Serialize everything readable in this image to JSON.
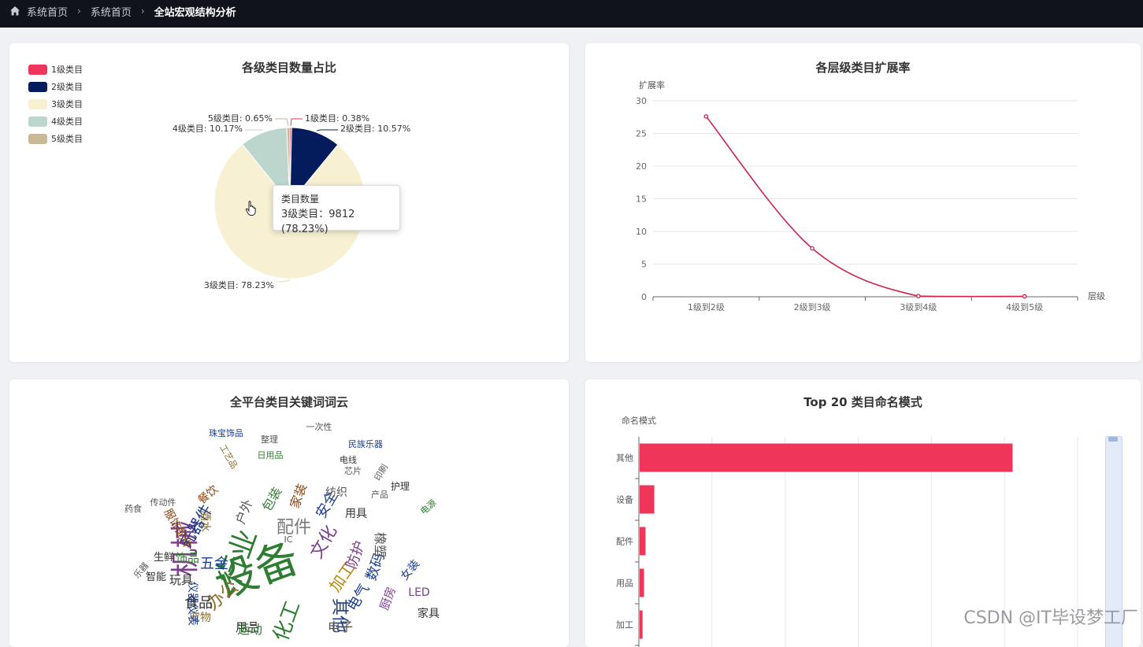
{
  "breadcrumb": {
    "items": [
      "系统首页",
      "系统首页",
      "全站宏观结构分析"
    ]
  },
  "pie_card": {
    "title": "各级类目数量占比",
    "legend": [
      {
        "label": "1级类目",
        "color": "#f0355a"
      },
      {
        "label": "2级类目",
        "color": "#051c5c"
      },
      {
        "label": "3级类目",
        "color": "#f8f0d2"
      },
      {
        "label": "4级类目",
        "color": "#bdd6cd"
      },
      {
        "label": "5级类目",
        "color": "#c8b895"
      }
    ],
    "slice_labels": [
      "1级类目: 0.38%",
      "2级类目: 10.57%",
      "3级类目: 78.23%",
      "4级类目: 10.17%",
      "5级类目: 0.65%"
    ],
    "tooltip": {
      "title": "类目数量",
      "text": "3级类目：9812 (78.23%)"
    }
  },
  "line_card": {
    "title": "各层级类目扩展率",
    "ylabel": "扩展率",
    "xlabel": "层级"
  },
  "cloud_card": {
    "title": "全平台类目关键词词云",
    "words": [
      {
        "t": "设备",
        "color": "#2e7d32"
      },
      {
        "t": "机械",
        "color": "#7b3f8c"
      },
      {
        "t": "行业",
        "color": "#2e7d32"
      },
      {
        "t": "配件",
        "color": "#7a7a7a"
      },
      {
        "t": "文化",
        "color": "#7b3f8c"
      },
      {
        "t": "加工",
        "color": "#b8860b"
      },
      {
        "t": "其他",
        "color": "#1a3c8c"
      },
      {
        "t": "化工",
        "color": "#2e7d32"
      },
      {
        "t": "办公",
        "color": "#8b6d2e"
      },
      {
        "t": "元器件",
        "color": "#1a3c8c"
      },
      {
        "t": "防护",
        "color": "#7b3f8c"
      },
      {
        "t": "安全",
        "color": "#1a3c8c"
      },
      {
        "t": "家装",
        "color": "#8b4513"
      },
      {
        "t": "户外",
        "color": "#555"
      },
      {
        "t": "包装",
        "color": "#2e7d32"
      },
      {
        "t": "食品",
        "color": "#333"
      },
      {
        "t": "五金",
        "color": "#1a3c8c"
      },
      {
        "t": "纺织",
        "color": "#555"
      },
      {
        "t": "用具",
        "color": "#333"
      },
      {
        "t": "数码",
        "color": "#1a3c8c"
      },
      {
        "t": "电气",
        "color": "#1a3c8c"
      },
      {
        "t": "厨房",
        "color": "#7b3f8c"
      },
      {
        "t": "饰品",
        "color": "#2e7d32"
      },
      {
        "t": "玩具",
        "color": "#333"
      },
      {
        "t": "服饰配件",
        "color": "#8b4513"
      },
      {
        "t": "用品",
        "color": "#333"
      },
      {
        "t": "餐饮",
        "color": "#8b4513"
      },
      {
        "t": "橡塑",
        "color": "#555"
      },
      {
        "t": "宠物",
        "color": "#8b6d2e"
      },
      {
        "t": "仪器仪表",
        "color": "#1a3c8c"
      },
      {
        "t": "智能",
        "color": "#333"
      },
      {
        "t": "酒水",
        "color": "#8b6d2e"
      },
      {
        "t": "生鲜",
        "color": "#333"
      },
      {
        "t": "珠宝饰品",
        "color": "#1a3c8c"
      },
      {
        "t": "民族乐器",
        "color": "#1a3c8c"
      },
      {
        "t": "电线",
        "color": "#333"
      },
      {
        "t": "印刷",
        "color": "#555"
      },
      {
        "t": "护理",
        "color": "#333"
      },
      {
        "t": "芯片",
        "color": "#555"
      },
      {
        "t": "工艺品",
        "color": "#8b6d2e"
      },
      {
        "t": "日用品",
        "color": "#2e7d32"
      },
      {
        "t": "一次性",
        "color": "#555"
      },
      {
        "t": "整理",
        "color": "#555"
      },
      {
        "t": "药食",
        "color": "#555"
      },
      {
        "t": "传动件",
        "color": "#555"
      },
      {
        "t": "产品",
        "color": "#555"
      },
      {
        "t": "电源",
        "color": "#2e7d32"
      },
      {
        "t": "LED",
        "color": "#7b3f8c"
      },
      {
        "t": "女装",
        "color": "#1a3c8c"
      },
      {
        "t": "家具",
        "color": "#333"
      },
      {
        "t": "运动",
        "color": "#2e7d32"
      },
      {
        "t": "IC",
        "color": "#555"
      },
      {
        "t": "电子",
        "color": "#555"
      },
      {
        "t": "乐器",
        "color": "#555"
      }
    ]
  },
  "bar_card": {
    "title": "Top 20 类目命名模式",
    "ylabel": "命名模式"
  },
  "watermark": "CSDN @IT毕设梦工厂",
  "chart_data": [
    {
      "type": "pie",
      "title": "各级类目数量占比",
      "categories": [
        "1级类目",
        "2级类目",
        "3级类目",
        "4级类目",
        "5级类目"
      ],
      "values": [
        0.38,
        10.57,
        78.23,
        10.17,
        0.65
      ],
      "unit": "%",
      "colors": [
        "#f0355a",
        "#051c5c",
        "#f8f0d2",
        "#bdd6cd",
        "#c8b895"
      ],
      "legend": "top-left",
      "highlighted": {
        "category": "3级类目",
        "count": 9812,
        "percent": 78.23
      }
    },
    {
      "type": "line",
      "title": "各层级类目扩展率",
      "xlabel": "层级",
      "ylabel": "扩展率",
      "categories": [
        "1级到2级",
        "2级到3级",
        "3级到4级",
        "4级到5级"
      ],
      "values": [
        27.6,
        7.4,
        0.1,
        0.06
      ],
      "ylim": [
        0,
        30
      ],
      "yticks": [
        0,
        5,
        10,
        15,
        20,
        25,
        30
      ],
      "color": "#c8274f",
      "smooth": true,
      "grid": true
    },
    {
      "type": "bar",
      "orientation": "horizontal",
      "title": "Top 20 类目命名模式",
      "ylabel": "命名模式",
      "categories": [
        "其他",
        "设备",
        "配件",
        "用品",
        "加工"
      ],
      "values": [
        510,
        20,
        8,
        6,
        4
      ],
      "xlim": [
        0,
        600
      ],
      "color": "#f0355a",
      "grid": true
    }
  ]
}
